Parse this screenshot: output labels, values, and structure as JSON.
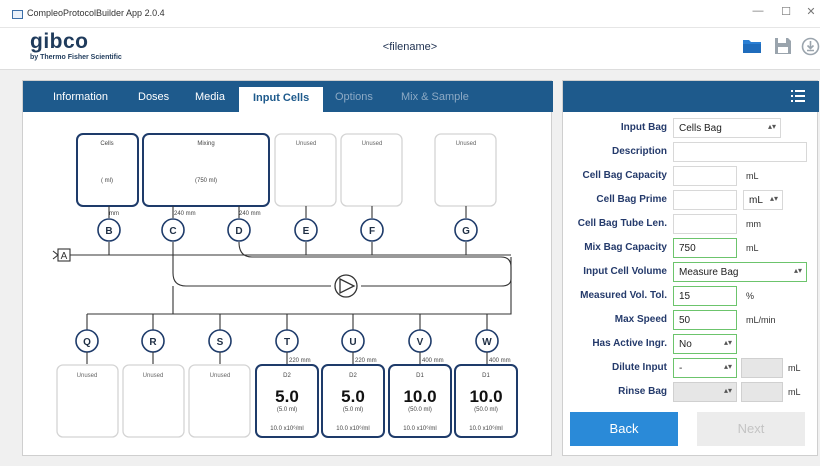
{
  "window": {
    "title": "CompleoProtocolBuilder App 2.0.4",
    "minimize": "—",
    "maximize": "☐",
    "close": "✕"
  },
  "header": {
    "logo": "gibco",
    "logo_sub": "by Thermo Fisher Scientific",
    "filename": "<filename>"
  },
  "tabs": [
    {
      "label": "Information",
      "state": "normal"
    },
    {
      "label": "Doses",
      "state": "normal"
    },
    {
      "label": "Media",
      "state": "normal"
    },
    {
      "label": "Input Cells",
      "state": "active"
    },
    {
      "label": "Options",
      "state": "disabled"
    },
    {
      "label": "Mix & Sample",
      "state": "disabled"
    }
  ],
  "diagram": {
    "top_bags": [
      {
        "port": "B",
        "title": "Cells",
        "volume": "( ml)",
        "tube": "mm",
        "style": "active"
      },
      {
        "port": "C",
        "title": "Mixing",
        "volume": "(750 ml)",
        "tube": "240 mm",
        "style": "active"
      },
      {
        "port": "D",
        "title": "Unused",
        "volume": "",
        "tube": "240 mm",
        "style": "unused"
      },
      {
        "port": "E",
        "title": "Unused",
        "volume": "",
        "tube": "",
        "style": "unused"
      },
      {
        "port": "F",
        "title": "",
        "volume": "",
        "tube": "",
        "style": "none"
      },
      {
        "port": "G",
        "title": "Unused",
        "volume": "",
        "tube": "",
        "style": "unused"
      }
    ],
    "a_label": "A",
    "bottom_bags": [
      {
        "port": "Q",
        "title": "Unused",
        "tube": "",
        "style": "unused"
      },
      {
        "port": "R",
        "title": "Unused",
        "tube": "",
        "style": "unused"
      },
      {
        "port": "S",
        "title": "Unused",
        "tube": "",
        "style": "unused"
      },
      {
        "port": "T",
        "title": "D2",
        "dose": "5.0",
        "dose_ml": "(5.0 ml)",
        "conc": "10.0 x10⁶/ml",
        "tube": "220 mm",
        "style": "dose"
      },
      {
        "port": "U",
        "title": "D2",
        "dose": "5.0",
        "dose_ml": "(5.0 ml)",
        "conc": "10.0 x10⁶/ml",
        "tube": "220 mm",
        "style": "dose"
      },
      {
        "port": "V",
        "title": "D1",
        "dose": "10.0",
        "dose_ml": "(50.0 ml)",
        "conc": "10.0 x10⁶/ml",
        "tube": "400 mm",
        "style": "dose"
      },
      {
        "port": "W",
        "title": "D1",
        "dose": "10.0",
        "dose_ml": "(50.0 ml)",
        "conc": "10.0 x10⁶/ml",
        "tube": "400 mm",
        "style": "dose"
      }
    ]
  },
  "form": {
    "input_bag": {
      "label": "Input Bag",
      "value": "Cells Bag"
    },
    "description": {
      "label": "Description",
      "value": ""
    },
    "cell_bag_capacity": {
      "label": "Cell Bag Capacity",
      "value": "",
      "unit": "mL"
    },
    "cell_bag_prime": {
      "label": "Cell Bag Prime",
      "value": "",
      "unit_select": "mL"
    },
    "cell_bag_tube_len": {
      "label": "Cell Bag Tube Len.",
      "value": "",
      "unit": "mm"
    },
    "mix_bag_capacity": {
      "label": "Mix Bag Capacity",
      "value": "750",
      "unit": "mL"
    },
    "input_cell_volume": {
      "label": "Input Cell Volume",
      "value": "Measure Bag"
    },
    "measured_vol_tol": {
      "label": "Measured Vol. Tol.",
      "value": "15",
      "unit": "%"
    },
    "max_speed": {
      "label": "Max Speed",
      "value": "50",
      "unit": "mL/min"
    },
    "has_active_ingr": {
      "label": "Has Active Ingr.",
      "value": "No"
    },
    "dilute_input": {
      "label": "Dilute Input",
      "value": "-",
      "unit": "mL"
    },
    "rinse_bag": {
      "label": "Rinse Bag",
      "value": "",
      "unit": "mL"
    }
  },
  "buttons": {
    "back": "Back",
    "next": "Next"
  },
  "colors": {
    "primary": "#1e5a8c",
    "accent_button": "#2a8ad8",
    "valid_border": "#6cc46c",
    "bag_border": "#1e3b6a",
    "disabled_tab": "#8daac5"
  }
}
